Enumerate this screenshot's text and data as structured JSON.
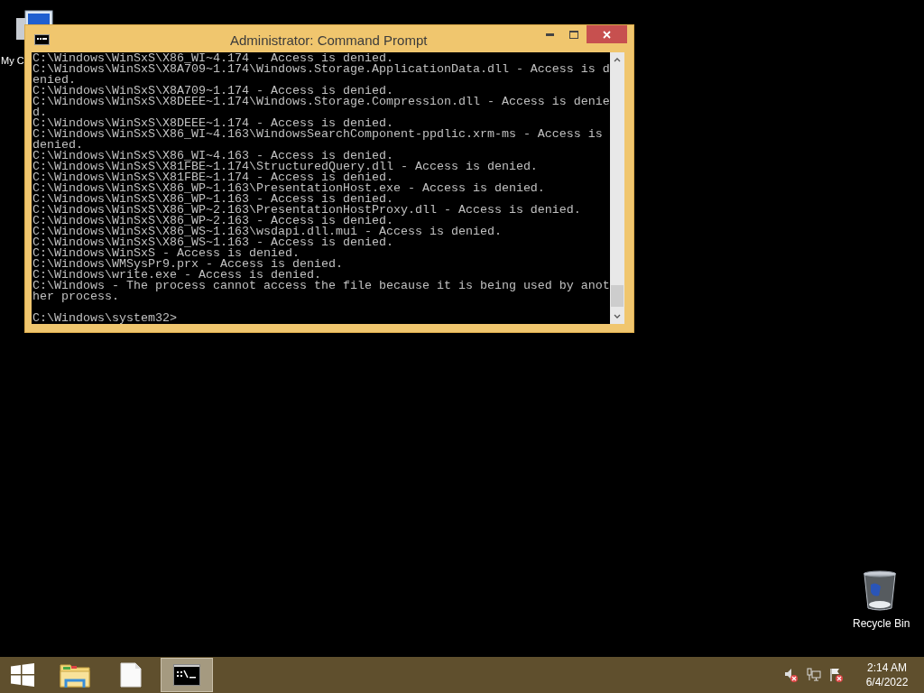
{
  "desktop_icons": [
    {
      "label": "My C",
      "kind": "computer"
    },
    {
      "label": "Recycle Bin",
      "kind": "recycle"
    }
  ],
  "window": {
    "title": "Administrator: Command Prompt",
    "lines": [
      "C:\\Windows\\WinSxS\\X86_WI~4.174 - Access is denied.",
      "C:\\Windows\\WinSxS\\X8A709~1.174\\Windows.Storage.ApplicationData.dll - Access is d",
      "enied.",
      "C:\\Windows\\WinSxS\\X8A709~1.174 - Access is denied.",
      "C:\\Windows\\WinSxS\\X8DEEE~1.174\\Windows.Storage.Compression.dll - Access is denie",
      "d.",
      "C:\\Windows\\WinSxS\\X8DEEE~1.174 - Access is denied.",
      "C:\\Windows\\WinSxS\\X86_WI~4.163\\WindowsSearchComponent-ppdlic.xrm-ms - Access is",
      "denied.",
      "C:\\Windows\\WinSxS\\X86_WI~4.163 - Access is denied.",
      "C:\\Windows\\WinSxS\\X81FBE~1.174\\StructuredQuery.dll - Access is denied.",
      "C:\\Windows\\WinSxS\\X81FBE~1.174 - Access is denied.",
      "C:\\Windows\\WinSxS\\X86_WP~1.163\\PresentationHost.exe - Access is denied.",
      "C:\\Windows\\WinSxS\\X86_WP~1.163 - Access is denied.",
      "C:\\Windows\\WinSxS\\X86_WP~2.163\\PresentationHostProxy.dll - Access is denied.",
      "C:\\Windows\\WinSxS\\X86_WP~2.163 - Access is denied.",
      "C:\\Windows\\WinSxS\\X86_WS~1.163\\wsdapi.dll.mui - Access is denied.",
      "C:\\Windows\\WinSxS\\X86_WS~1.163 - Access is denied.",
      "C:\\Windows\\WinSxS - Access is denied.",
      "C:\\Windows\\WMSysPr9.prx - Access is denied.",
      "C:\\Windows\\write.exe - Access is denied.",
      "C:\\Windows - The process cannot access the file because it is being used by anot",
      "her process."
    ],
    "prompt": "C:\\Windows\\system32>"
  },
  "taskbar": {
    "apps": [
      {
        "kind": "explorer",
        "selected": false
      },
      {
        "kind": "file",
        "selected": false
      },
      {
        "kind": "console",
        "selected": true
      }
    ],
    "tray": [
      {
        "kind": "volume"
      },
      {
        "kind": "network"
      },
      {
        "kind": "flag"
      }
    ],
    "time": "2:14 AM",
    "date": "6/4/2022"
  }
}
